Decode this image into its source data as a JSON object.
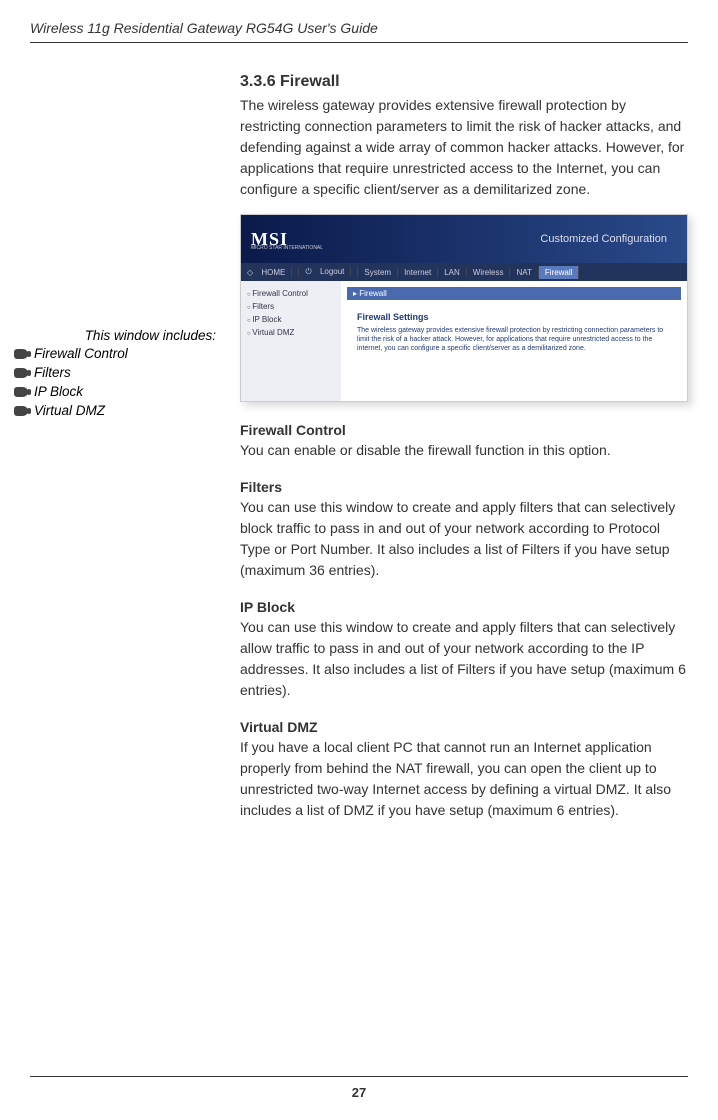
{
  "header": "Wireless 11g Residential Gateway RG54G User's Guide",
  "section": {
    "number": "3.3.6  Firewall",
    "intro": "The wireless gateway provides extensive firewall protection by restricting connection parameters to limit the risk of hacker attacks, and defending against a wide array of common hacker attacks.  However, for applications that require unrestricted access to the Internet, you can configure a specific client/server as a demilitarized zone."
  },
  "sidebar_note": {
    "title": "This window includes:",
    "items": [
      "Firewall Control",
      "Filters",
      "IP Block",
      "Virtual DMZ"
    ]
  },
  "screenshot": {
    "logo": "MSI",
    "logo_sub": "MICRO STAR INTERNATIONAL",
    "banner_title": "Customized Configuration",
    "nav": {
      "home": "HOME",
      "logout": "Logout",
      "tabs": [
        "System",
        "Internet",
        "LAN",
        "Wireless",
        "NAT"
      ],
      "active": "Firewall"
    },
    "sidebar_items": [
      "Firewall Control",
      "Filters",
      "IP Block",
      "Virtual DMZ"
    ],
    "panel_head": "Firewall",
    "settings_title": "Firewall Settings",
    "settings_text": "The wireless gateway provides extensive firewall protection by restricting connection parameters to limit the risk of a hacker attack. However, for applications that require unrestricted access to the internet, you can configure a specific client/server as a demilitarized zone."
  },
  "subsections": [
    {
      "title": "Firewall Control",
      "body": "You can enable or disable the firewall function in this option."
    },
    {
      "title": "Filters",
      "body": "You can use this window to create and apply filters that can selectively block traffic to pass in and out of your network according to Protocol Type or Port Number.  It also includes a list of Filters if you have setup (maximum 36 entries)."
    },
    {
      "title": "IP Block",
      "body": "You can use this window to create and apply filters that can selectively allow traffic to pass in and out of your network according to the IP addresses.  It also includes a list of Filters if you have setup (maximum 6 entries)."
    },
    {
      "title": "Virtual DMZ",
      "body": "If you have a local client PC that cannot run an Internet application properly from behind the NAT firewall, you can open the client up to unrestricted two-way Internet access by defining a virtual  DMZ.  It also includes a list of DMZ if you have setup (maximum 6 entries)."
    }
  ],
  "page_number": "27"
}
